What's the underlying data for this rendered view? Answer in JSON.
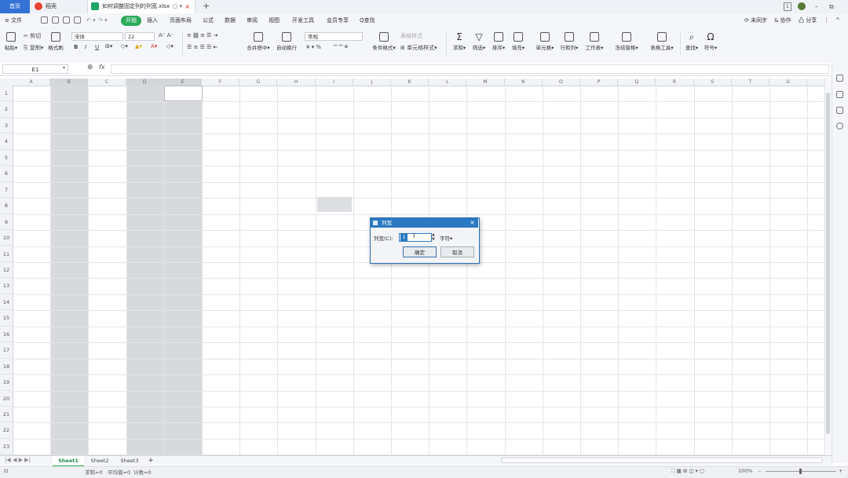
{
  "titlebar": {
    "home_tab": "首页",
    "daoke_tab": "稻壳",
    "doc_tab": "如何调整固定列的列宽.xlsx",
    "doc_close": "×",
    "doc_pin": "▢ ▾",
    "new_tab": "+",
    "window_count": "1",
    "minimize": "–",
    "restore": "⧉"
  },
  "menubar": {
    "file": "≡ 文件",
    "tabs": [
      "开始",
      "插入",
      "页面布局",
      "公式",
      "数据",
      "审阅",
      "视图",
      "开发工具",
      "会员专享",
      "Q查找"
    ],
    "right": [
      "⟳ 未同步",
      "& 协作",
      "凸 分享",
      "⋮",
      "^"
    ]
  },
  "ribbon": {
    "paste": "粘贴▾",
    "cut": "✂ 剪切",
    "copy": "⎘ 复制▾",
    "format_painter": "格式刷",
    "font_name": "宋体",
    "font_size": "22",
    "bold": "B",
    "italic": "I",
    "underline": "U",
    "merge_center": "合并居中▾",
    "wrap": "自动换行",
    "number_format": "常规",
    "percent": "¥ ▾ %",
    "cond_format": "条件格式▾",
    "table_style": "表格样式",
    "cell_style": "⊞ 单元格样式▾",
    "sum": "求和▾",
    "filter": "筛选▾",
    "sort": "排序▾",
    "fill": "填充▾",
    "cells": "单元格▾",
    "rows_cols": "行和列▾",
    "worksheet": "工作表▾",
    "freeze": "冻结窗格▾",
    "table_tools": "表格工具▾",
    "find": "查找▾",
    "symbol": "符号▾"
  },
  "formula_bar": {
    "name_box": "E1",
    "fx": "fx",
    "zoom_icon": "⊕"
  },
  "columns": [
    "A",
    "B",
    "C",
    "D",
    "E",
    "F",
    "G",
    "H",
    "I",
    "J",
    "K",
    "L",
    "M",
    "N",
    "O",
    "P",
    "Q",
    "R",
    "S",
    "T",
    "U"
  ],
  "rows": [
    "1",
    "2",
    "3",
    "4",
    "5",
    "6",
    "7",
    "8",
    "9",
    "10",
    "11",
    "12",
    "13",
    "14",
    "15",
    "16",
    "17",
    "18",
    "19",
    "20",
    "21",
    "22",
    "23"
  ],
  "sheets": [
    "Sheet1",
    "Sheet2",
    "Sheet3"
  ],
  "sheet_add": "+",
  "status": {
    "sum": "求和=0",
    "avg": "平均值=0",
    "count": "计数=0",
    "zoom": "100%",
    "zoom_minus": "–",
    "zoom_plus": "+"
  },
  "dialog": {
    "title": "列宽",
    "close": "×",
    "label": "列宽(C):",
    "value": "1",
    "unit": "字符▾",
    "ok": "确定",
    "cancel": "取消"
  },
  "colors": {
    "accent_blue": "#2b79c2",
    "start_green": "#2bab5a",
    "selected_column": "#d7d9dd"
  }
}
